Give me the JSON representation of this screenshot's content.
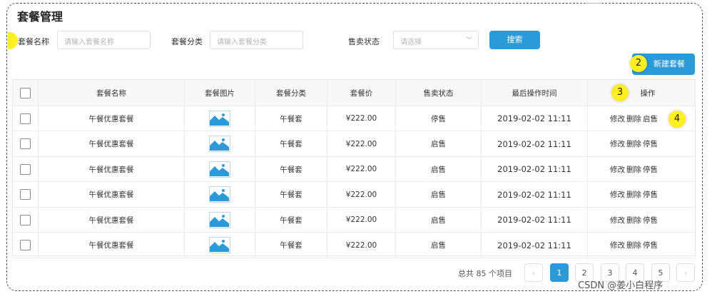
{
  "page": {
    "title": "套餐管理",
    "watermark": "CSDN @姜小白程序"
  },
  "filters": {
    "name_label": "套餐名称",
    "name_placeholder": "请输入套餐名称",
    "category_label": "套餐分类",
    "category_placeholder": "请输入套餐分类",
    "status_label": "售卖状态",
    "status_placeholder": "请选择",
    "search_label": "搜索"
  },
  "actions": {
    "new_label": "新建套餐"
  },
  "markers": [
    "2",
    "3",
    "4"
  ],
  "table": {
    "headers": [
      "套餐名称",
      "套餐图片",
      "套餐分类",
      "套餐价",
      "售卖状态",
      "最后操作时间",
      "操作"
    ],
    "rows": [
      {
        "name": "午餐优惠套餐",
        "category": "午餐套",
        "price": "¥222.00",
        "status": "停售",
        "time": "2019-02-02 11:11",
        "edit": "修改",
        "delete": "删除",
        "toggle": "启售"
      },
      {
        "name": "午餐优惠套餐",
        "category": "午餐套",
        "price": "¥222.00",
        "status": "启售",
        "time": "2019-02-02 11:11",
        "edit": "修改",
        "delete": "删除",
        "toggle": "停售"
      },
      {
        "name": "午餐优惠套餐",
        "category": "午餐套",
        "price": "¥222.00",
        "status": "启售",
        "time": "2019-02-02 11:11",
        "edit": "修改",
        "delete": "删除",
        "toggle": "停售"
      },
      {
        "name": "午餐优惠套餐",
        "category": "午餐套",
        "price": "¥222.00",
        "status": "启售",
        "time": "2019-02-02 11:11",
        "edit": "修改",
        "delete": "删除",
        "toggle": "停售"
      },
      {
        "name": "午餐优惠套餐",
        "category": "午餐套",
        "price": "¥222.00",
        "status": "启售",
        "time": "2019-02-02 11:11",
        "edit": "修改",
        "delete": "删除",
        "toggle": "停售"
      },
      {
        "name": "午餐优惠套餐",
        "category": "午餐套",
        "price": "¥222.00",
        "status": "启售",
        "time": "2019-02-02 11:11",
        "edit": "修改",
        "delete": "删除",
        "toggle": "停售"
      }
    ]
  },
  "pagination": {
    "total_text": "总共 85 个项目",
    "prev": "‹",
    "next": "›",
    "pages": [
      "1",
      "2",
      "3",
      "4",
      "5"
    ],
    "current": "1"
  },
  "colors": {
    "accent": "#2a9bd8",
    "marker": "#ffee22"
  }
}
